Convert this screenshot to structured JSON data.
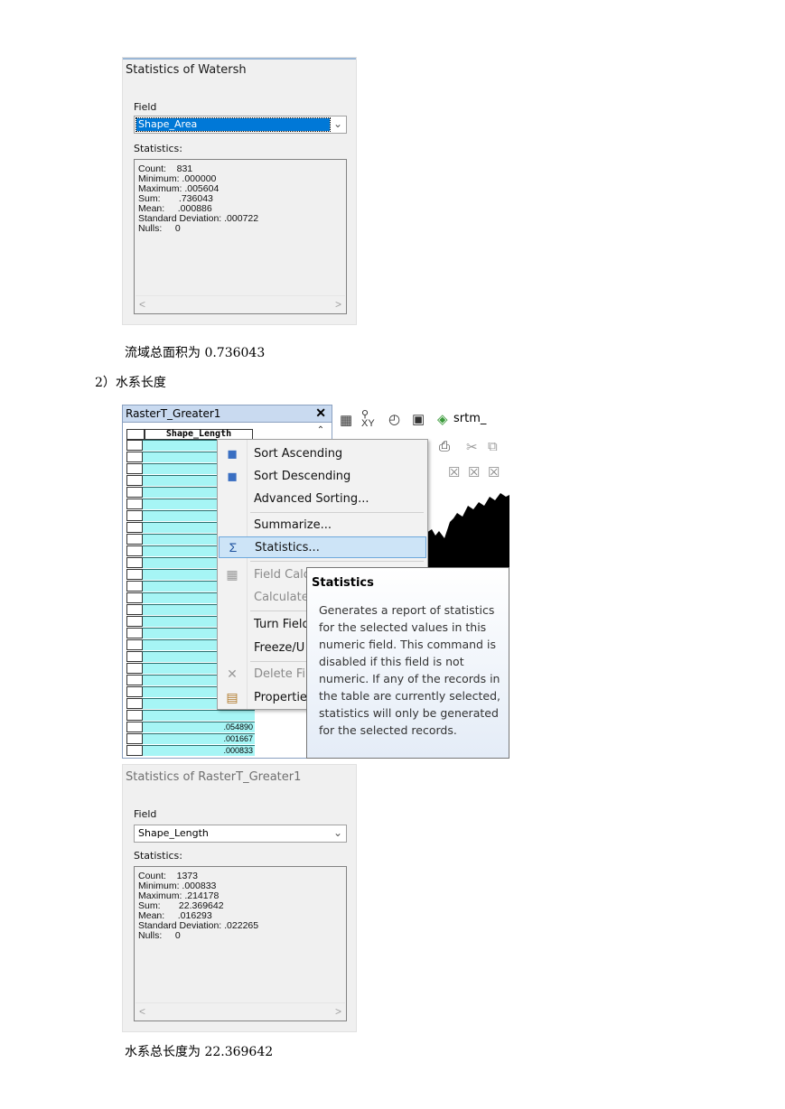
{
  "panel1": {
    "title": "Statistics of Watersh",
    "field_label": "Field",
    "field_value": "Shape_Area",
    "stats_label": "Statistics:",
    "lines": [
      "Count:    831",
      "Minimum: .000000",
      "Maximum: .005604",
      "Sum:       .736043",
      "Mean:     .000886",
      "Standard Deviation: .000722",
      "Nulls:     0"
    ]
  },
  "caption1": "流域总面积为 0.736043",
  "heading2": "2）水系长度",
  "table_window": {
    "title": "RasterT_Greater1",
    "column_header": "Shape_Length",
    "values": [
      ".054890",
      ".001667",
      ".000833"
    ]
  },
  "toolbar": {
    "layer_name": "srtm_"
  },
  "context_menu": {
    "items": [
      {
        "label": "Sort Ascending",
        "icon": "sort-ascending-icon"
      },
      {
        "label": "Sort Descending",
        "icon": "sort-descending-icon"
      },
      {
        "label": "Advanced Sorting...",
        "icon": ""
      },
      {
        "label": "Summarize...",
        "icon": ""
      },
      {
        "label": "Statistics...",
        "icon": "sigma-icon"
      },
      {
        "label": "Field Calc",
        "icon": "calculator-icon"
      },
      {
        "label": "Calculate",
        "icon": ""
      },
      {
        "label": "Turn Field",
        "icon": ""
      },
      {
        "label": "Freeze/U",
        "icon": ""
      },
      {
        "label": "Delete Fi",
        "icon": "delete-icon"
      },
      {
        "label": "Propertie",
        "icon": "properties-icon"
      }
    ]
  },
  "tooltip": {
    "title": "Statistics",
    "body": "Generates a report of statistics for the selected values in this numeric field. This command is disabled if this field is not numeric. If any of the records in the table are currently selected, statistics will only be generated for the selected records."
  },
  "panel2": {
    "title": "Statistics of RasterT_Greater1",
    "field_label": "Field",
    "field_value": "Shape_Length",
    "stats_label": "Statistics:",
    "lines": [
      "Count:    1373",
      "Minimum: .000833",
      "Maximum: .214178",
      "Sum:       22.369642",
      "Mean:     .016293",
      "Standard Deviation: .022265",
      "Nulls:     0"
    ]
  },
  "caption2": "水系总长度为 22.369642",
  "colors": {
    "selection_blue": "#0078d7",
    "cell_cyan": "#a6f5f5",
    "menu_highlight": "#cde4f7"
  }
}
